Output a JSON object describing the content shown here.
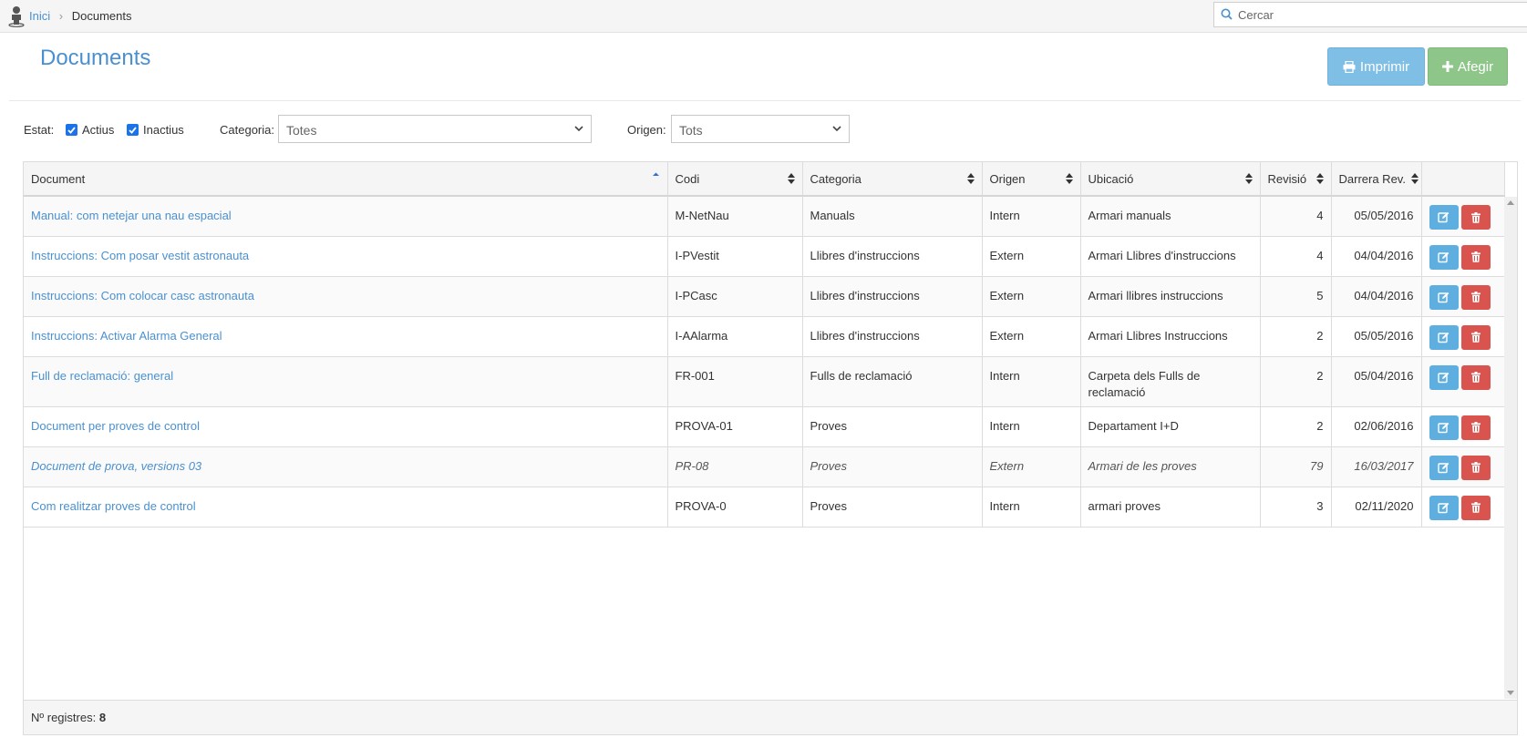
{
  "breadcrumb": {
    "home": "Inici",
    "current": "Documents"
  },
  "search": {
    "placeholder": "Cercar",
    "value": ""
  },
  "page": {
    "title": "Documents"
  },
  "actions": {
    "print_label": "Imprimir",
    "add_label": "Afegir"
  },
  "filters": {
    "estat_label": "Estat:",
    "actius_label": "Actius",
    "actius_checked": true,
    "inactius_label": "Inactius",
    "inactius_checked": true,
    "categoria_label": "Categoria:",
    "categoria_value": "Totes",
    "origen_label": "Origen:",
    "origen_value": "Tots"
  },
  "table": {
    "columns": [
      "Document",
      "Codi",
      "Categoria",
      "Origen",
      "Ubicació",
      "Revisió",
      "Darrera Rev."
    ],
    "rows": [
      {
        "document": "Manual: com netejar una nau espacial",
        "codi": "M-NetNau",
        "categoria": "Manuals",
        "origen": "Intern",
        "ubicacio": "Armari manuals",
        "revisio": "4",
        "darrera": "05/05/2016"
      },
      {
        "document": "Instruccions: Com posar vestit astronauta",
        "codi": "I-PVestit",
        "categoria": "Llibres d'instruccions",
        "origen": "Extern",
        "ubicacio": "Armari Llibres d'instruccions",
        "revisio": "4",
        "darrera": "04/04/2016"
      },
      {
        "document": "Instruccions: Com colocar casc astronauta",
        "codi": "I-PCasc",
        "categoria": "Llibres d'instruccions",
        "origen": "Extern",
        "ubicacio": "Armari llibres instruccions",
        "revisio": "5",
        "darrera": "04/04/2016"
      },
      {
        "document": "Instruccions: Activar Alarma General",
        "codi": "I-AAlarma",
        "categoria": "Llibres d'instruccions",
        "origen": "Extern",
        "ubicacio": "Armari Llibres Instruccions",
        "revisio": "2",
        "darrera": "05/05/2016"
      },
      {
        "document": "Full de reclamació: general",
        "codi": "FR-001",
        "categoria": "Fulls de reclamació",
        "origen": "Intern",
        "ubicacio": "Carpeta dels Fulls de reclamació",
        "revisio": "2",
        "darrera": "05/04/2016"
      },
      {
        "document": "Document per proves de control",
        "codi": "PROVA-01",
        "categoria": "Proves",
        "origen": "Intern",
        "ubicacio": "Departament I+D",
        "revisio": "2",
        "darrera": "02/06/2016"
      },
      {
        "document": "Document de prova, versions 03",
        "codi": "PR-08",
        "categoria": "Proves",
        "origen": "Extern",
        "ubicacio": "Armari de les proves",
        "revisio": "79",
        "darrera": "16/03/2017"
      },
      {
        "document": "Com realitzar proves de control",
        "codi": "PROVA-0",
        "categoria": "Proves",
        "origen": "Intern",
        "ubicacio": "armari proves",
        "revisio": "3",
        "darrera": "02/11/2020"
      }
    ]
  },
  "footer": {
    "label": "Nº registres:",
    "count": "8"
  },
  "colors": {
    "accent": "#4a90d0",
    "print": "#7fbfe6",
    "add": "#8ec689",
    "edit": "#5eaee0",
    "delete": "#d9534f"
  }
}
